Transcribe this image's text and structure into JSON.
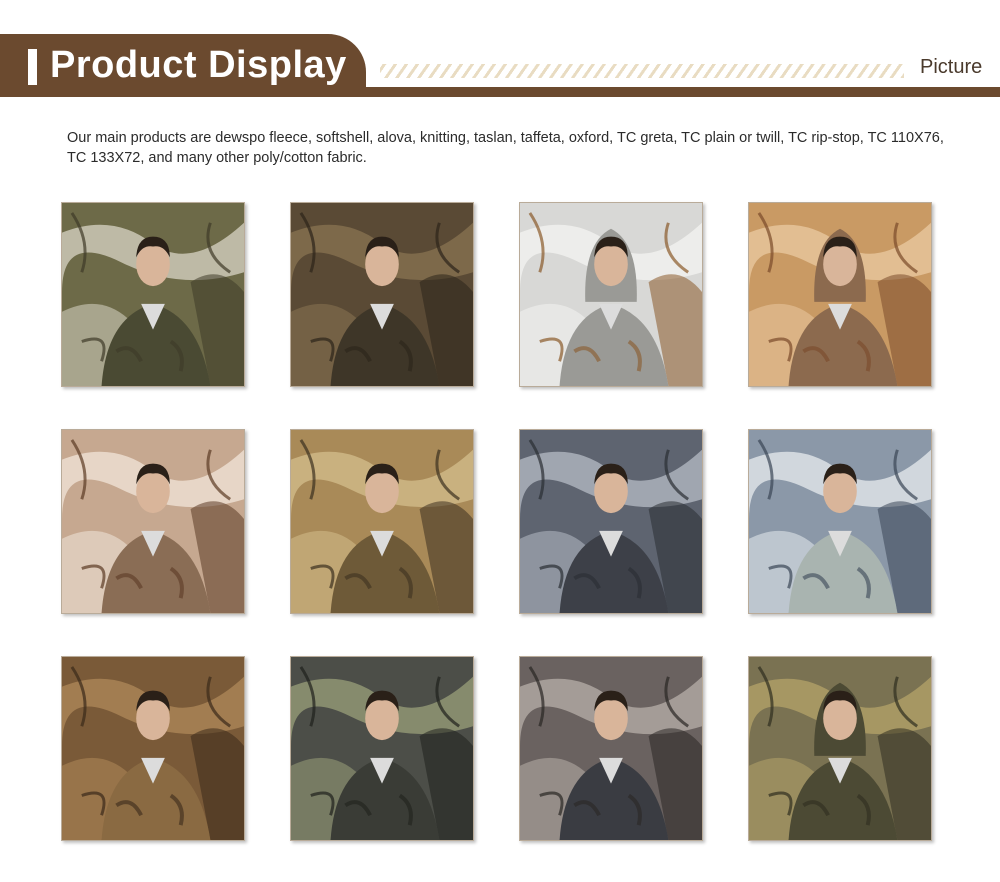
{
  "header": {
    "title": "Product Display",
    "right_label": "Picture",
    "brand_color": "#6b4a2f"
  },
  "intro": {
    "text": "Our main products are dewspo fleece, softshell, alova, knitting, taslan, taffeta, oxford, TC greta, TC plain or twill, TC rip-stop, TC 110X76, TC 133X72, and many other poly/cotton fabric."
  },
  "gallery": {
    "items": [
      {
        "pattern": "olive-branch-camo",
        "bg": "#6d6a48",
        "c1": "#d9d5c6",
        "c2": "#3e3b28",
        "jacket": "#4a4a33",
        "hood": false
      },
      {
        "pattern": "dark-reed-camo",
        "bg": "#5a4a35",
        "c1": "#8a7452",
        "c2": "#2c2419",
        "jacket": "#3e3628",
        "hood": false
      },
      {
        "pattern": "snow-branch-camo",
        "bg": "#d8d8d6",
        "c1": "#f4f4f2",
        "c2": "#8a5a2a",
        "jacket": "#9a9a96",
        "hood": true
      },
      {
        "pattern": "desert-brush-camo",
        "bg": "#c99a64",
        "c1": "#e9c9a1",
        "c2": "#7a4a2a",
        "jacket": "#8c6a4e",
        "hood": true
      },
      {
        "pattern": "winter-reed-camo",
        "bg": "#c6a890",
        "c1": "#f1e6da",
        "c2": "#5b3a24",
        "jacket": "#8a6d55",
        "hood": false
      },
      {
        "pattern": "tan-leaf-camo",
        "bg": "#a98a58",
        "c1": "#d4bd8c",
        "c2": "#3c3020",
        "jacket": "#6e5a38",
        "hood": false
      },
      {
        "pattern": "hex-grey-camo",
        "bg": "#5e6470",
        "c1": "#b7bcc6",
        "c2": "#2a2d33",
        "jacket": "#3d4048",
        "hood": false
      },
      {
        "pattern": "ice-blue-camo",
        "bg": "#8b98a8",
        "c1": "#e8ecef",
        "c2": "#3b4656",
        "jacket": "#a9b4b0",
        "hood": false
      },
      {
        "pattern": "mud-brown-camo",
        "bg": "#7a5a38",
        "c1": "#b08a5a",
        "c2": "#3b2a1a",
        "jacket": "#8a6a42",
        "hood": false
      },
      {
        "pattern": "forest-dark-camo",
        "bg": "#4c4e48",
        "c1": "#9aa07a",
        "c2": "#1f211d",
        "jacket": "#3a3c36",
        "hood": false
      },
      {
        "pattern": "digital-grey-camo",
        "bg": "#6a6260",
        "c1": "#b8b0aa",
        "c2": "#2a2624",
        "jacket": "#3a3c42",
        "hood": false
      },
      {
        "pattern": "net-mesh-camo",
        "bg": "#7a7252",
        "c1": "#b5a46a",
        "c2": "#2f2d20",
        "jacket": "#4c4a34",
        "hood": true
      }
    ]
  }
}
